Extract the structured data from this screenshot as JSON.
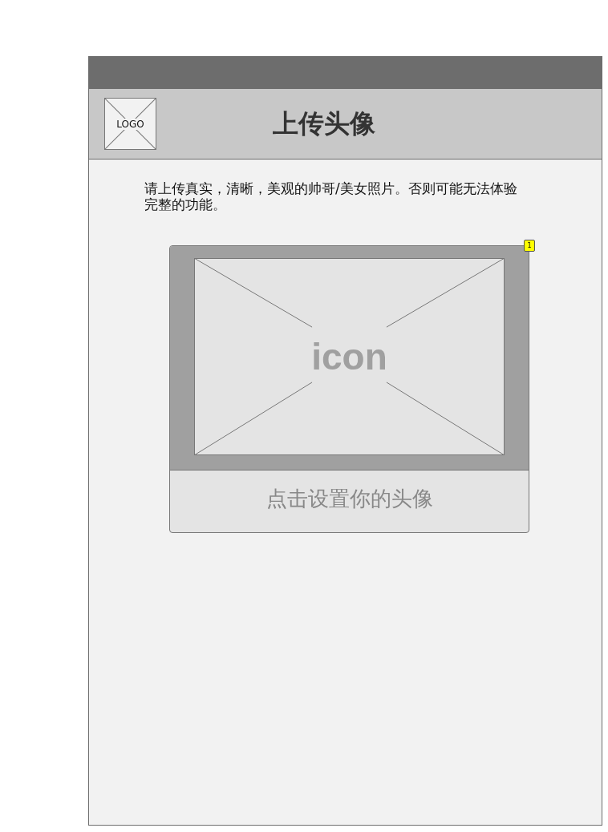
{
  "header": {
    "logo": "LOGO",
    "title": "上传头像"
  },
  "description": "请上传真实，清晰，美观的帅哥/美女照片。否则可能无法体验完整的功能。",
  "avatar_card": {
    "placeholder": "icon",
    "button": "点击设置你的头像",
    "note_badge": "1"
  }
}
